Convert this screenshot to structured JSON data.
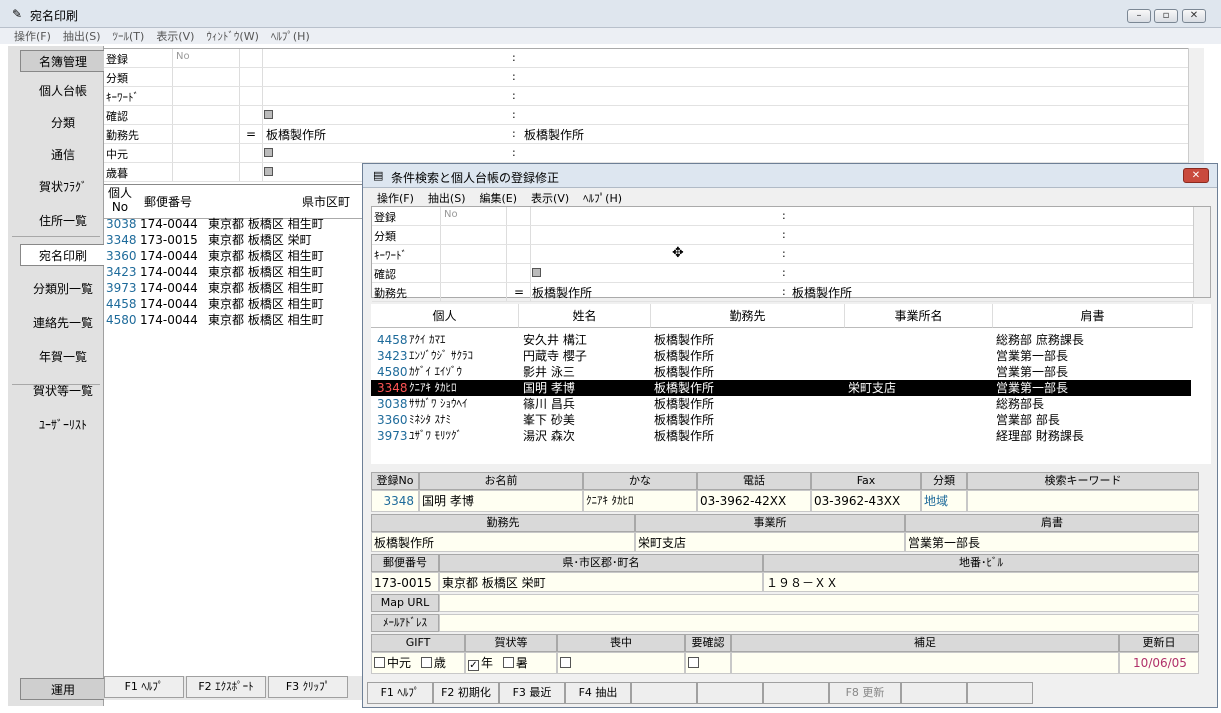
{
  "app": {
    "title": "宛名印刷",
    "menu": [
      "操作(F)",
      "抽出(S)",
      "ﾂｰﾙ(T)",
      "表示(V)",
      "ｳｨﾝﾄﾞｳ(W)",
      "ﾍﾙﾌﾟ(H)"
    ],
    "sidebar": [
      "名簿管理",
      "個人台帳",
      "分類",
      "通信",
      "賀状ﾌﾗｸﾞ",
      "住所一覧",
      "宛名印刷",
      "分類別一覧",
      "連絡先一覧",
      "年賀一覧",
      "賀状等一覧",
      "ﾕｰｻﾞｰﾘｽﾄ"
    ],
    "sidebar_bottom": "運用",
    "filter_labels": [
      "登録",
      "分類",
      "ｷｰﾜｰﾄﾞ",
      "確認",
      "勤務先",
      "中元",
      "歳暮"
    ],
    "filter_no_placeholder": "No",
    "filter_eq": "=",
    "filter_company": "板橋製作所",
    "filter_company_right": "板橋製作所",
    "grid_headers": {
      "no": "個人\nNo",
      "zip": "郵便番号",
      "addr": "県市区町"
    },
    "grid_rows": [
      {
        "no": "3038",
        "zip": "174-0044",
        "addr": "東京都 板橋区 相生町"
      },
      {
        "no": "3348",
        "zip": "173-0015",
        "addr": "東京都 板橋区 栄町"
      },
      {
        "no": "3360",
        "zip": "174-0044",
        "addr": "東京都 板橋区 相生町"
      },
      {
        "no": "3423",
        "zip": "174-0044",
        "addr": "東京都 板橋区 相生町"
      },
      {
        "no": "3973",
        "zip": "174-0044",
        "addr": "東京都 板橋区 相生町"
      },
      {
        "no": "4458",
        "zip": "174-0044",
        "addr": "東京都 板橋区 相生町"
      },
      {
        "no": "4580",
        "zip": "174-0044",
        "addr": "東京都 板橋区 相生町"
      }
    ],
    "fkeys": [
      "F1 ﾍﾙﾌﾟ",
      "F2 ｴｸｽﾎﾟｰﾄ",
      "F3 ｸﾘｯﾌﾟ"
    ]
  },
  "dialog": {
    "title": "条件検索と個人台帳の登録修正",
    "menu": [
      "操作(F)",
      "抽出(S)",
      "編集(E)",
      "表示(V)",
      "ﾍﾙﾌﾟ(H)"
    ],
    "filter_labels": [
      "登録",
      "分類",
      "ｷｰﾜｰﾄﾞ",
      "確認",
      "勤務先"
    ],
    "filter_no_placeholder": "No",
    "filter_eq": "=",
    "filter_company": "板橋製作所",
    "filter_company_right": "板橋製作所",
    "list_headers": [
      "個人",
      "姓名",
      "勤務先",
      "事業所名",
      "肩書"
    ],
    "list_rows": [
      {
        "no": "4458",
        "kana": "ｱｸｲ ｶﾏｴ",
        "name": "安久井 構江",
        "company": "板橋製作所",
        "office": "",
        "title": "総務部 庶務課長"
      },
      {
        "no": "3423",
        "kana": "ｴﾝｿﾞｳｼﾞ ｻｸﾗｺ",
        "name": "円蔵寺 櫻子",
        "company": "板橋製作所",
        "office": "",
        "title": "営業第一部長"
      },
      {
        "no": "4580",
        "kana": "ｶｹﾞｲ ｴｲｿﾞｳ",
        "name": "影井 泳三",
        "company": "板橋製作所",
        "office": "",
        "title": "営業第一部長"
      },
      {
        "no": "3348",
        "kana": "ｸﾆｱｷ ﾀｶﾋﾛ",
        "name": "国明 孝博",
        "company": "板橋製作所",
        "office": "栄町支店",
        "title": "営業第一部長",
        "selected": true
      },
      {
        "no": "3038",
        "kana": "ｻｻｶﾞﾜ ｼｮｳﾍｲ",
        "name": "篠川 昌兵",
        "company": "板橋製作所",
        "office": "",
        "title": "総務部長"
      },
      {
        "no": "3360",
        "kana": "ﾐﾈｼﾀ ｽﾅﾐ",
        "name": "峯下 砂美",
        "company": "板橋製作所",
        "office": "",
        "title": "営業部 部長"
      },
      {
        "no": "3973",
        "kana": "ﾕｻﾞﾜ ﾓﾘﾂｸﾞ",
        "name": "湯沢 森次",
        "company": "板橋製作所",
        "office": "",
        "title": "経理部 財務課長"
      }
    ],
    "detail": {
      "h_no": "登録No",
      "h_name": "お名前",
      "h_kana": "かな",
      "h_tel": "電話",
      "h_fax": "Fax",
      "h_cat": "分類",
      "h_kw": "検索キーワード",
      "no": "3348",
      "name": "国明 孝博",
      "kana": "ｸﾆｱｷ ﾀｶﾋﾛ",
      "tel": "03-3962-42XX",
      "fax": "03-3962-43XX",
      "cat": "地域",
      "h_company": "勤務先",
      "h_office": "事業所",
      "h_title": "肩書",
      "company": "板橋製作所",
      "office": "栄町支店",
      "title": "営業第一部長",
      "h_zip": "郵便番号",
      "h_addr": "県･市区郡･町名",
      "h_block": "地番･ﾋﾞﾙ",
      "zip": "173-0015",
      "addr": "東京都 板橋区 栄町",
      "block": "１９８－ＸＸ",
      "h_map": "Map URL",
      "h_mail": "ﾒｰﾙｱﾄﾞﾚｽ",
      "h_gift": "GIFT",
      "h_card": "賀状等",
      "h_mourn": "喪中",
      "h_confirm": "要確認",
      "h_note": "補足",
      "h_updated": "更新日",
      "gift_chu": "中元",
      "gift_sai": "歳",
      "card_nen": "年",
      "card_sho": "暑",
      "updated": "10/06/05"
    },
    "fkeys": [
      "F1 ﾍﾙﾌﾟ",
      "F2 初期化",
      "F3 最近",
      "F4 抽出",
      "",
      "",
      "",
      "F8 更新",
      "",
      ""
    ]
  },
  "colors": {
    "selected_bg": "#000000",
    "selected_no": "#ff3333",
    "blue_no": "#1d6a9a",
    "yellow_field": "#fffff2"
  }
}
